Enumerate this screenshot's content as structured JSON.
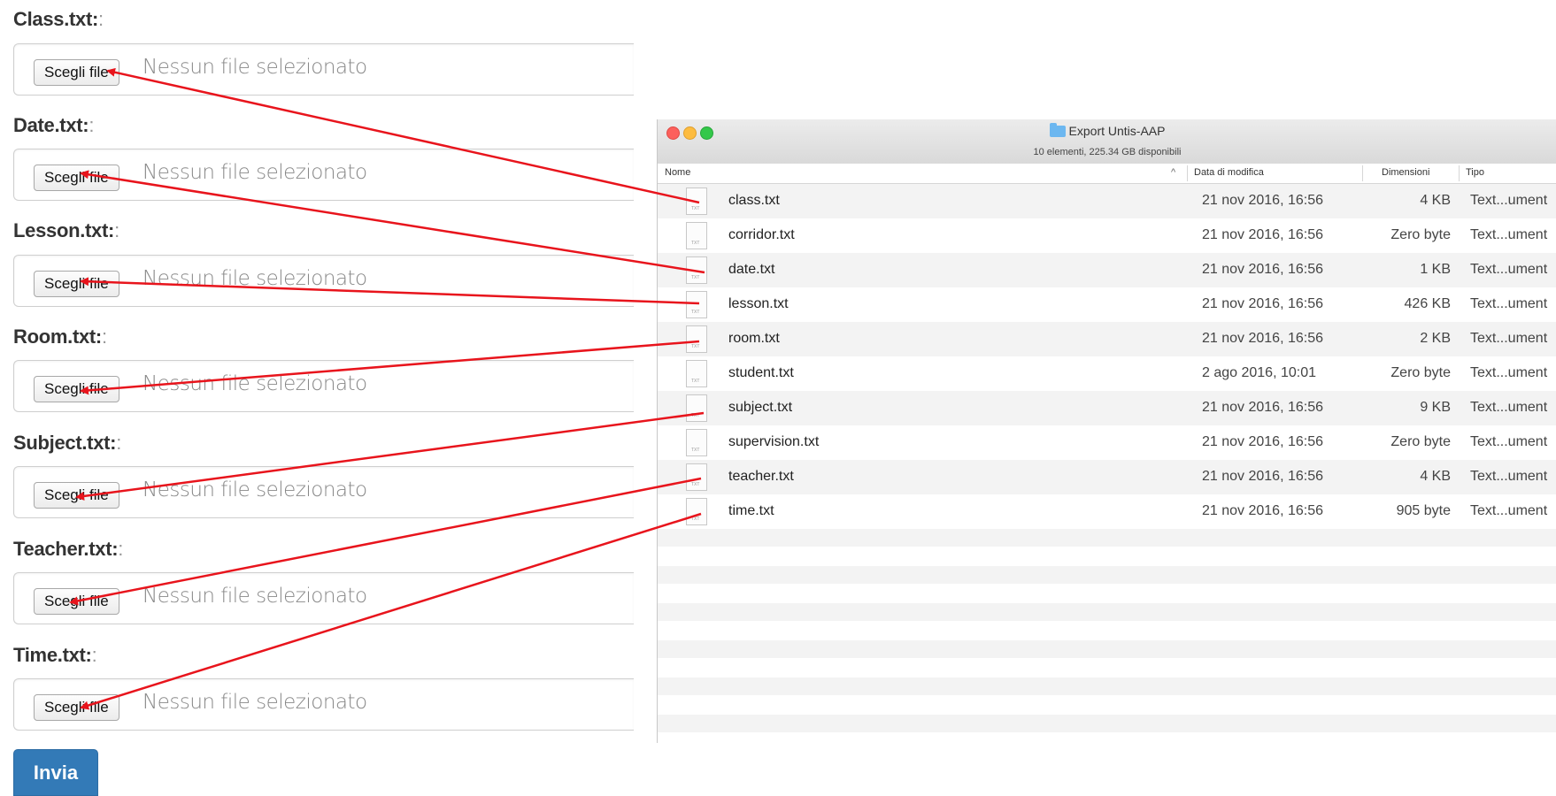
{
  "form": {
    "fields": [
      {
        "label": "Class.txt:",
        "colon": ":",
        "button": "Scegli file",
        "status": "Nessun file selezionato"
      },
      {
        "label": "Date.txt:",
        "colon": ":",
        "button": "Scegli file",
        "status": "Nessun file selezionato"
      },
      {
        "label": "Lesson.txt:",
        "colon": ":",
        "button": "Scegli file",
        "status": "Nessun file selezionato"
      },
      {
        "label": "Room.txt:",
        "colon": ":",
        "button": "Scegli file",
        "status": "Nessun file selezionato"
      },
      {
        "label": "Subject.txt:",
        "colon": ":",
        "button": "Scegli file",
        "status": "Nessun file selezionato"
      },
      {
        "label": "Teacher.txt:",
        "colon": ":",
        "button": "Scegli file",
        "status": "Nessun file selezionato"
      },
      {
        "label": "Time.txt:",
        "colon": ":",
        "button": "Scegli file",
        "status": "Nessun file selezionato"
      }
    ],
    "submit_label": "Invia"
  },
  "finder": {
    "title": "Export Untis-AAP",
    "subtitle": "10 elementi, 225.34 GB disponibili",
    "columns": {
      "name": "Nome",
      "sort_indicator": "^",
      "date": "Data di modifica",
      "size": "Dimensioni",
      "type": "Tipo"
    },
    "files": [
      {
        "name": "class.txt",
        "date": "21 nov 2016, 16:56",
        "size": "4 KB",
        "type": "Text...ument"
      },
      {
        "name": "corridor.txt",
        "date": "21 nov 2016, 16:56",
        "size": "Zero byte",
        "type": "Text...ument"
      },
      {
        "name": "date.txt",
        "date": "21 nov 2016, 16:56",
        "size": "1 KB",
        "type": "Text...ument"
      },
      {
        "name": "lesson.txt",
        "date": "21 nov 2016, 16:56",
        "size": "426 KB",
        "type": "Text...ument"
      },
      {
        "name": "room.txt",
        "date": "21 nov 2016, 16:56",
        "size": "2 KB",
        "type": "Text...ument"
      },
      {
        "name": "student.txt",
        "date": "2 ago 2016, 10:01",
        "size": "Zero byte",
        "type": "Text...ument"
      },
      {
        "name": "subject.txt",
        "date": "21 nov 2016, 16:56",
        "size": "9 KB",
        "type": "Text...ument"
      },
      {
        "name": "supervision.txt",
        "date": "21 nov 2016, 16:56",
        "size": "Zero byte",
        "type": "Text...ument"
      },
      {
        "name": "teacher.txt",
        "date": "21 nov 2016, 16:56",
        "size": "4 KB",
        "type": "Text...ument"
      },
      {
        "name": "time.txt",
        "date": "21 nov 2016, 16:56",
        "size": "905 byte",
        "type": "Text...ument"
      }
    ]
  },
  "annotation": {
    "arrow_color": "#e8141c"
  }
}
